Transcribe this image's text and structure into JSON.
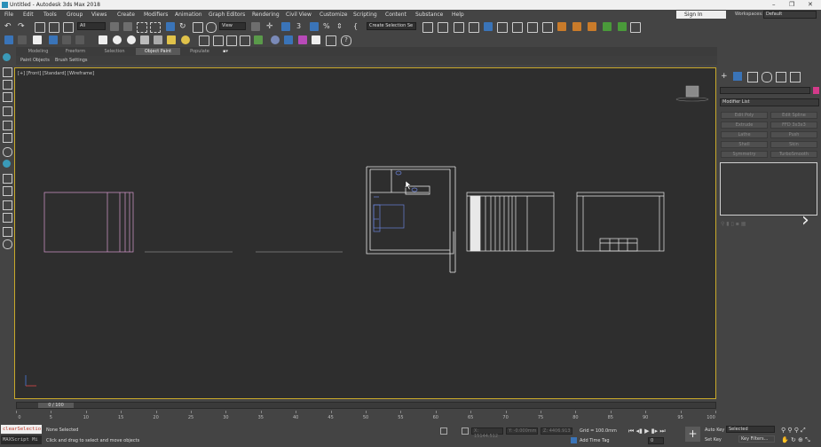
{
  "window": {
    "title": "Untitled - Autodesk 3ds Max 2018"
  },
  "menu": [
    "File",
    "Edit",
    "Tools",
    "Group",
    "Views",
    "Create",
    "Modifiers",
    "Animation",
    "Graph Editors",
    "Rendering",
    "Civil View",
    "Customize",
    "Scripting",
    "Content",
    "Substance",
    "Help"
  ],
  "account": {
    "sign_in": "Sign In",
    "workspaces_label": "Workspaces:",
    "workspace": "Default"
  },
  "toolbar": {
    "filter": "All",
    "ref_coord": "View",
    "selection_set": "Create Selection Se"
  },
  "ribbon": {
    "tabs": [
      "Modeling",
      "Freeform",
      "Selection",
      "Object Paint",
      "Populate"
    ],
    "active_tab": "Object Paint",
    "sub": [
      "Paint Objects",
      "Brush Settings"
    ]
  },
  "viewport": {
    "label": "[+] [Front] [Standard] [Wireframe]"
  },
  "command_panel": {
    "modifier_list": "Modifier List",
    "buttons": [
      "Edit Poly",
      "Edit Spline",
      "Extrude",
      "FFD 3x3x3",
      "Lathe",
      "Push",
      "Shell",
      "Skin",
      "Symmetry",
      "TurboSmooth"
    ]
  },
  "timeline": {
    "slider": "0 / 100",
    "ticks": [
      "0",
      "5",
      "10",
      "15",
      "20",
      "25",
      "30",
      "35",
      "40",
      "45",
      "50",
      "55",
      "60",
      "65",
      "70",
      "75",
      "80",
      "85",
      "90",
      "95",
      "100"
    ]
  },
  "status": {
    "script1": "clearSelectio",
    "script2": "MAXScript Mi",
    "selection": "None Selected",
    "prompt": "Click and drag to select and move objects",
    "x": "X: 15144.512",
    "y": "Y: -0.000mm",
    "z": "Z: 4406.913",
    "grid": "Grid = 100.0mm",
    "add_time_tag": "Add Time Tag",
    "frame": "0",
    "auto_key": "Auto Key",
    "set_key": "Set Key",
    "key_mode": "Selected",
    "key_filters": "Key Filters..."
  },
  "colors": {
    "viewport_border": "#c9a92a",
    "wire_white": "#e8e8e8",
    "wire_pink": "#d79bd0",
    "wire_blue": "#6a82d8"
  }
}
